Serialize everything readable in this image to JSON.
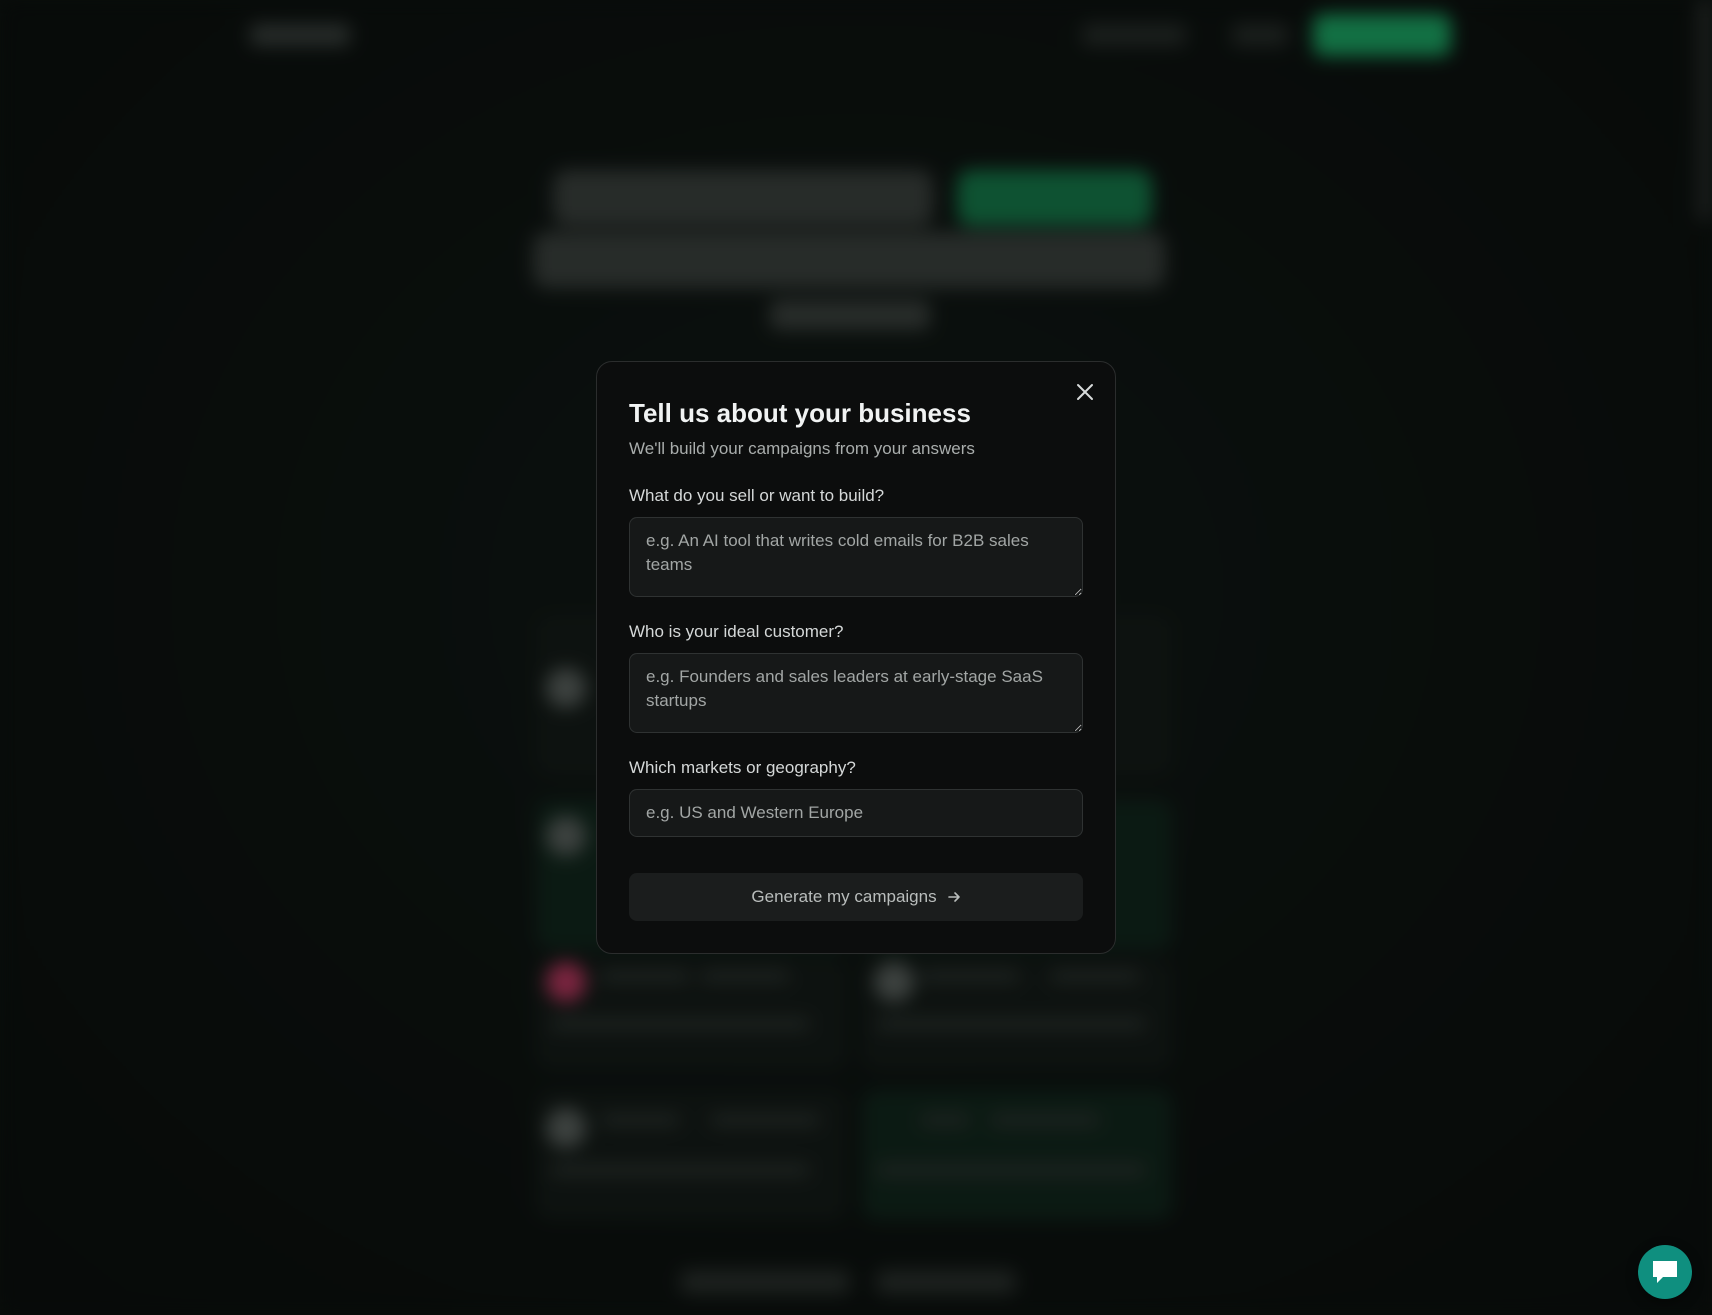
{
  "modal": {
    "title": "Tell us about your business",
    "subtitle": "We'll build your campaigns from your answers",
    "fields": [
      {
        "label": "What do you sell or want to build?",
        "value": "",
        "placeholder": "e.g. An AI tool that writes cold emails for B2B sales teams"
      },
      {
        "label": "Who is your ideal customer?",
        "value": "",
        "placeholder": "e.g. Founders and sales leaders at early-stage SaaS startups"
      },
      {
        "label": "Which markets or geography?",
        "value": "",
        "placeholder": "e.g. US and Western Europe"
      }
    ],
    "submit_label": "Generate my campaigns",
    "submit_icon": "arrow-right-icon",
    "close_icon": "close-icon"
  },
  "chat_widget": {
    "icon": "chat-bubble-icon"
  },
  "colors": {
    "modal_background": "#0c0d0d",
    "modal_border": "#2b2d2d",
    "field_background": "#161818",
    "button_background": "#1b1d1d",
    "chat_launcher": "#0f8f7f",
    "brand_green": "#1aa865"
  }
}
